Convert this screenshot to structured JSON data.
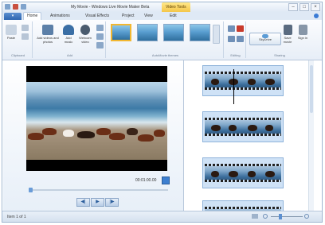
{
  "window": {
    "title": "My Movie - Windows Live Movie Maker Beta",
    "contextual_tab_group": "Video Tools"
  },
  "tabs": [
    {
      "label": "Home"
    },
    {
      "label": "Animations"
    },
    {
      "label": "Visual Effects"
    },
    {
      "label": "Project"
    },
    {
      "label": "View"
    },
    {
      "label": "Edit"
    }
  ],
  "ribbon": {
    "clipboard": {
      "label": "Clipboard",
      "paste": "Paste"
    },
    "add": {
      "label": "Add",
      "add_videos": "Add videos and photos",
      "add_music": "Add music",
      "webcam": "Webcam video"
    },
    "autoMovie": {
      "label": "AutoMovie themes"
    },
    "editing": {
      "label": "Editing"
    },
    "sharing": {
      "label": "Sharing",
      "skydrive": "SkyDrive",
      "save_movie": "Save movie",
      "sign_in": "Sign in"
    }
  },
  "preview": {
    "time": "00:01:00.00"
  },
  "status": {
    "item_text": "Item 1 of 1"
  },
  "zoom": {
    "level": 0.3
  }
}
